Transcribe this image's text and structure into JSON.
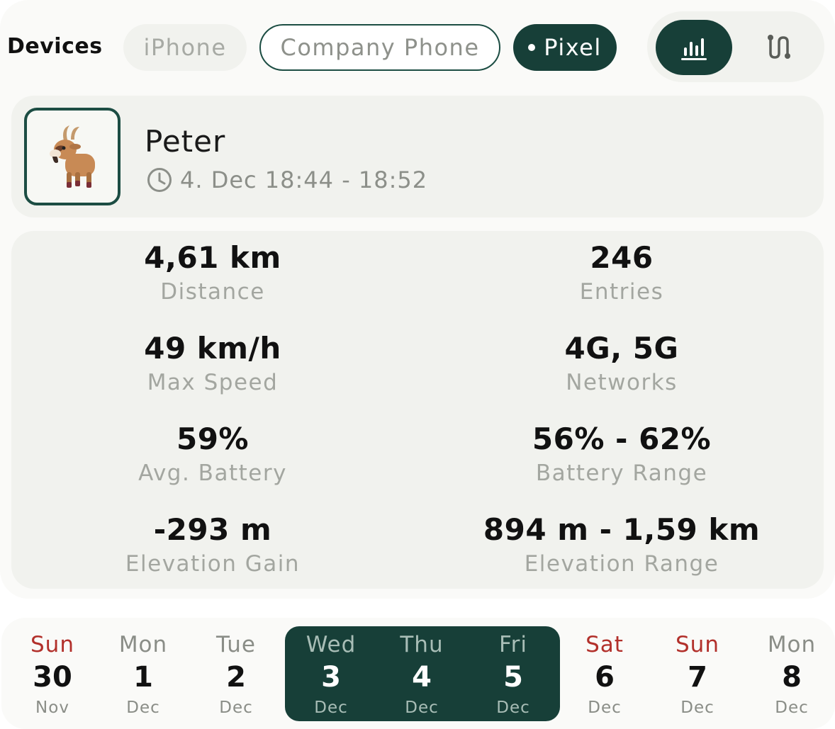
{
  "header": {
    "devices_label": "Devices",
    "devices": [
      {
        "label": "iPhone",
        "state": "inactive"
      },
      {
        "label": "Company Phone",
        "state": "outlined"
      },
      {
        "label": "Pixel",
        "state": "selected"
      }
    ],
    "view_toggle": {
      "active": "stats-icon",
      "options": [
        "stats-icon",
        "route-icon"
      ]
    }
  },
  "profile": {
    "name": "Peter",
    "time_range": "4. Dec 18:44 - 18:52",
    "avatar_icon": "goat-icon"
  },
  "stats": [
    {
      "value": "4,61 km",
      "label": "Distance"
    },
    {
      "value": "246",
      "label": "Entries"
    },
    {
      "value": "49 km/h",
      "label": "Max Speed"
    },
    {
      "value": "4G, 5G",
      "label": "Networks"
    },
    {
      "value": "59%",
      "label": "Avg. Battery"
    },
    {
      "value": "56% - 62%",
      "label": "Battery Range"
    },
    {
      "value": "-293 m",
      "label": "Elevation Gain"
    },
    {
      "value": "894 m - 1,59 km",
      "label": "Elevation Range"
    }
  ],
  "calendar": {
    "days": [
      {
        "weekday": "Sun",
        "day": "30",
        "month": "Nov",
        "weekend": true,
        "selected": false
      },
      {
        "weekday": "Mon",
        "day": "1",
        "month": "Dec",
        "weekend": false,
        "selected": false
      },
      {
        "weekday": "Tue",
        "day": "2",
        "month": "Dec",
        "weekend": false,
        "selected": false
      },
      {
        "weekday": "Wed",
        "day": "3",
        "month": "Dec",
        "weekend": false,
        "selected": true
      },
      {
        "weekday": "Thu",
        "day": "4",
        "month": "Dec",
        "weekend": false,
        "selected": true
      },
      {
        "weekday": "Fri",
        "day": "5",
        "month": "Dec",
        "weekend": false,
        "selected": true
      },
      {
        "weekday": "Sat",
        "day": "6",
        "month": "Dec",
        "weekend": true,
        "selected": false
      },
      {
        "weekday": "Sun",
        "day": "7",
        "month": "Dec",
        "weekend": true,
        "selected": false
      },
      {
        "weekday": "Mon",
        "day": "8",
        "month": "Dec",
        "weekend": false,
        "selected": false
      }
    ]
  },
  "colors": {
    "accent": "#173f38",
    "card": "#f1f2ee",
    "weekend": "#b2302b",
    "muted": "#a3a6a0"
  }
}
